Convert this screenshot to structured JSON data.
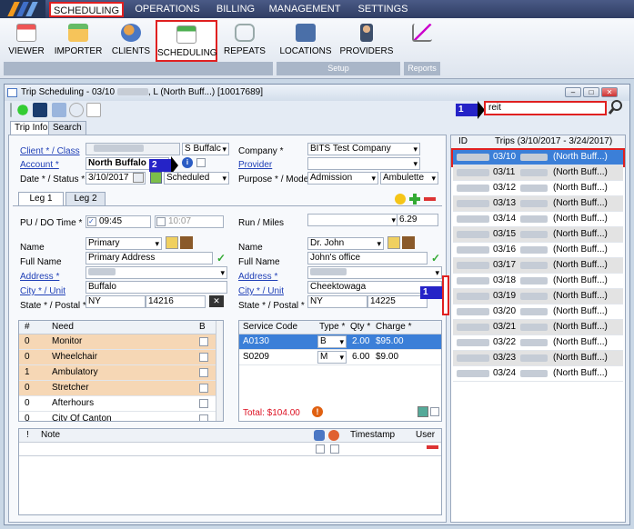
{
  "nav": {
    "tabs": [
      "SCHEDULING",
      "OPERATIONS",
      "BILLING",
      "MANAGEMENT",
      "SETTINGS"
    ]
  },
  "ribbon": {
    "buttons": [
      "VIEWER",
      "IMPORTER",
      "CLIENTS",
      "SCHEDULING",
      "REPEATS",
      "LOCATIONS",
      "PROVIDERS"
    ],
    "groups": [
      "Setup",
      "Reports"
    ]
  },
  "window": {
    "title": "Trip Scheduling - 03/10",
    "title_rest": ", L (North Buff...) [10017689]"
  },
  "search": {
    "value": "reit"
  },
  "tabs": {
    "trip_info": "Trip Info",
    "search": "Search"
  },
  "form": {
    "client_label": "Client * / Class",
    "class_value": "S Buffalc",
    "account_label": "Account *",
    "account_value": "North Buffalo DC",
    "date_label": "Date * / Status *",
    "date_value": "3/10/2017",
    "status_value": "Scheduled",
    "company_label": "Company *",
    "company_value": "BITS Test Company",
    "provider_label": "Provider",
    "purpose_label": "Purpose * / Mode *",
    "purpose_value": "Admission",
    "mode_value": "Ambulette",
    "leg1": "Leg 1",
    "leg2": "Leg 2",
    "pu_label": "PU / DO Time *",
    "pu_value": "09:45",
    "do_value": "10:07",
    "run_label": "Run / Miles",
    "miles_value": "6.29",
    "left": {
      "name_label": "Name",
      "name_value": "Primary",
      "full_label": "Full Name",
      "full_value": "Primary Address",
      "addr_label": "Address *",
      "city_label": "City * / Unit",
      "city_value": "Buffalo",
      "state_label": "State * / Postal *",
      "state_value": "NY",
      "postal_value": "14216"
    },
    "right": {
      "name_label": "Name",
      "name_value": "Dr. John",
      "full_label": "Full Name",
      "full_value": "John's office",
      "addr_label": "Address *",
      "city_label": "City * / Unit",
      "city_value": "Cheektowaga",
      "state_label": "State * / Postal *",
      "state_value": "NY",
      "postal_value": "14225"
    }
  },
  "needs": {
    "headers": [
      "#",
      "Need",
      "B"
    ],
    "rows": [
      {
        "n": "0",
        "need": "Monitor"
      },
      {
        "n": "0",
        "need": "Wheelchair"
      },
      {
        "n": "1",
        "need": "Ambulatory"
      },
      {
        "n": "0",
        "need": "Stretcher"
      },
      {
        "n": "0",
        "need": "Afterhours"
      },
      {
        "n": "0",
        "need": "City Of Canton"
      }
    ]
  },
  "services": {
    "headers": [
      "Service Code",
      "Type *",
      "Qty *",
      "Charge *"
    ],
    "rows": [
      {
        "code": "A0130",
        "type": "B",
        "qty": "2.00",
        "charge": "$95.00"
      },
      {
        "code": "S0209",
        "type": "M",
        "qty": "6.00",
        "charge": "$9.00"
      }
    ],
    "total": "Total: $104.00"
  },
  "notes": {
    "headers": [
      "!",
      "Note",
      "Timestamp",
      "User"
    ]
  },
  "trips": {
    "headers": [
      "ID",
      "Trips (3/10/2017 - 3/24/2017)"
    ],
    "suffix": "(North Buff...)",
    "dates": [
      "03/10",
      "03/11",
      "03/12",
      "03/13",
      "03/14",
      "03/15",
      "03/16",
      "03/17",
      "03/18",
      "03/19",
      "03/20",
      "03/21",
      "03/22",
      "03/23",
      "03/24"
    ]
  },
  "markers": [
    "1",
    "2",
    "1"
  ]
}
